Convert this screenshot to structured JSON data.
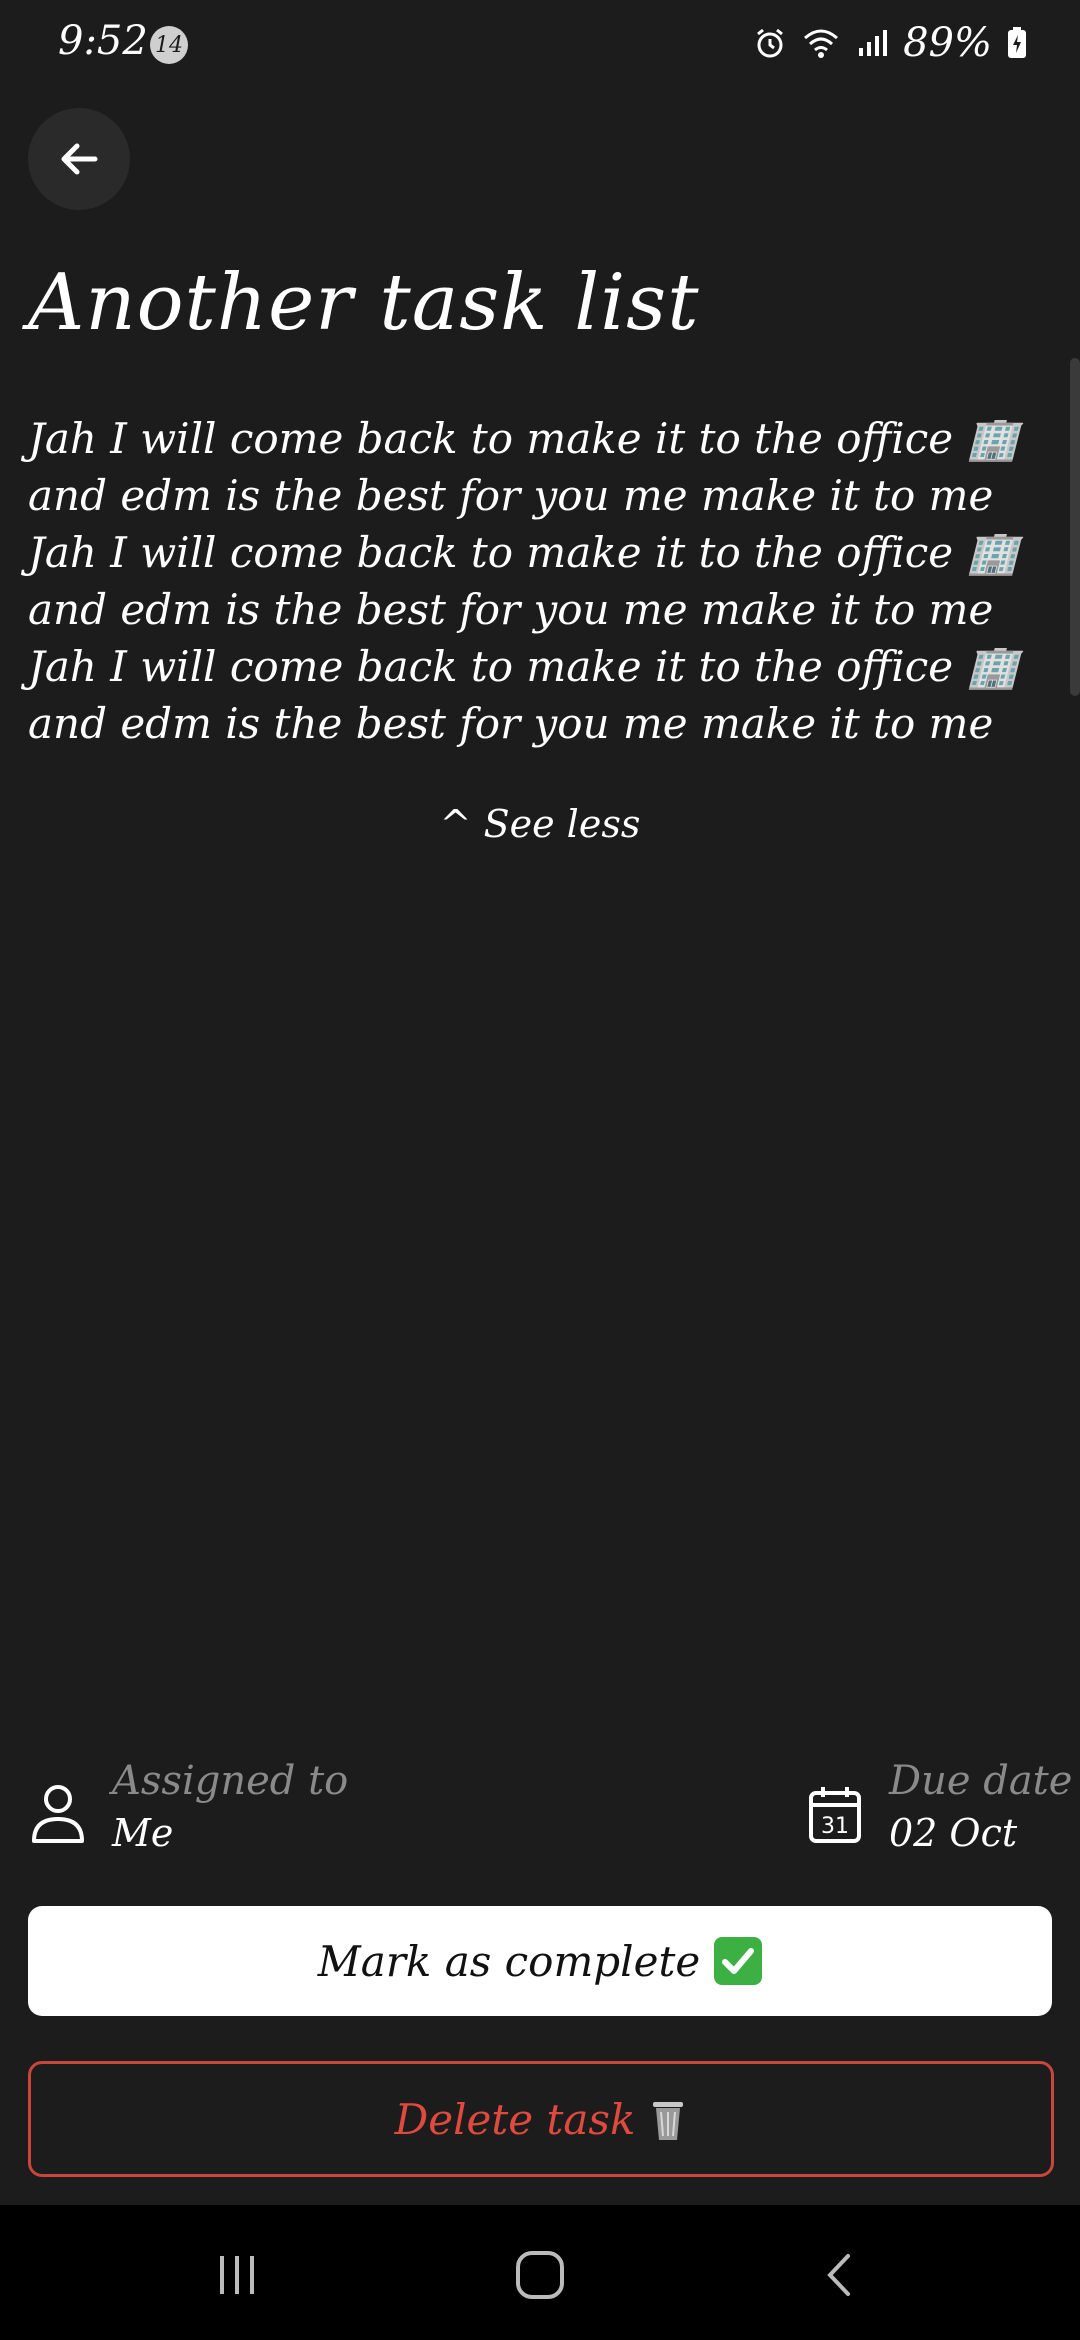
{
  "status_bar": {
    "time": "9:52",
    "notification_count": "14",
    "battery": "89%"
  },
  "task": {
    "title": "Another task list",
    "description_lines": [
      "Jah I will come back to make it to the office 🏢",
      "and edm is the best for you me make it to me",
      "Jah I will come back to make it to the office 🏢",
      "and edm is the best for you me make it to me",
      "Jah I will come back to make it to the office 🏢",
      "and edm is the best for you me make it to me"
    ],
    "see_less_label": "^ See less",
    "assigned_label": "Assigned to",
    "assigned_value": "Me",
    "due_label": "Due date",
    "due_value": "02 Oct",
    "calendar_day": "31"
  },
  "actions": {
    "complete_label": "Mark as complete",
    "delete_label": "Delete task"
  },
  "colors": {
    "background": "#1c1c1c",
    "delete_accent": "#e04a3e",
    "muted_text": "#8a8a8a"
  }
}
